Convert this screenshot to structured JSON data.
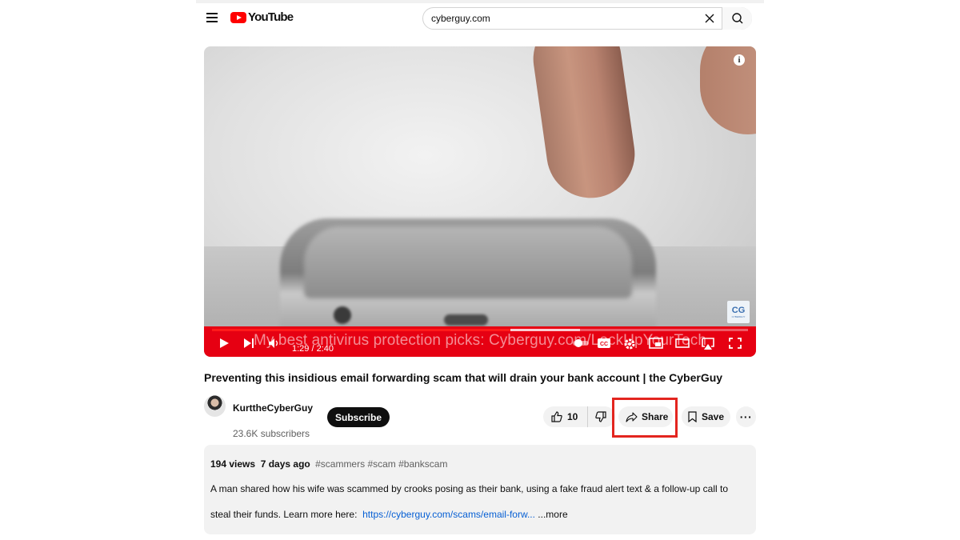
{
  "header": {
    "logo_text": "YouTube",
    "search_value": "cyberguy.com"
  },
  "player": {
    "time_current": "1:29",
    "time_total": "2:40",
    "time_display": "1:29 / 2:40",
    "progress_fraction": 0.556,
    "caption": "My best antivirus protection picks: Cyberguy.com/LockUpYourTech",
    "watermark_label": "CYBERGUY",
    "info_glyph": "i"
  },
  "video": {
    "title": "Preventing this insidious email forwarding scam that will drain your bank account | the CyberGuy"
  },
  "channel": {
    "name": "KurttheCyberGuy",
    "subscribers": "23.6K subscribers",
    "subscribe_label": "Subscribe"
  },
  "actions": {
    "like_count": "10",
    "share_label": "Share",
    "save_label": "Save",
    "more_label": "···"
  },
  "description": {
    "views": "194 views",
    "age": "7 days ago",
    "tags": "#scammers #scam #bankscam",
    "line1": "A man shared how his wife was scammed by crooks posing as their bank, using a fake fraud alert text & a follow-up call to",
    "line2_prefix": "steal their funds. Learn more here:",
    "link_text": "https://cyberguy.com/scams/email-forw...",
    "more_label": "...more"
  },
  "colors": {
    "brand_red": "#ff0000",
    "controls_bg": "#e60012",
    "highlight_box": "#e3251f",
    "link": "#065fd4"
  }
}
